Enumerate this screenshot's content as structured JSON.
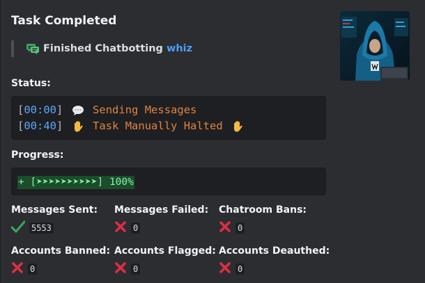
{
  "embed": {
    "title": "Task Completed",
    "description_prefix": "Finished Chatbotting",
    "description_user": "whiz",
    "accent_user_color": "#4f9cf7"
  },
  "status": {
    "label": "Status:",
    "lines": [
      {
        "time": "00:00",
        "emoji": "speech-balloon-icon",
        "text": "Sending Messages"
      },
      {
        "time": "00:40",
        "emoji": "raised-hand-icon",
        "text": "Task Manually Halted"
      }
    ]
  },
  "progress": {
    "label": "Progress:",
    "text": "+ [➤➤➤➤➤➤➤➤➤➤] 100%",
    "percent": 100
  },
  "fields": [
    {
      "name": "Messages Sent:",
      "icon": "check-icon",
      "value": "5553"
    },
    {
      "name": "Messages Failed:",
      "icon": "x-icon",
      "value": "0"
    },
    {
      "name": "Chatroom Bans:",
      "icon": "x-icon",
      "value": "0"
    },
    {
      "name": "Accounts Banned:",
      "icon": "x-icon",
      "value": "0"
    },
    {
      "name": "Accounts Flagged:",
      "icon": "x-icon",
      "value": "0"
    },
    {
      "name": "Accounts Deauthed:",
      "icon": "x-icon",
      "value": "0"
    }
  ]
}
